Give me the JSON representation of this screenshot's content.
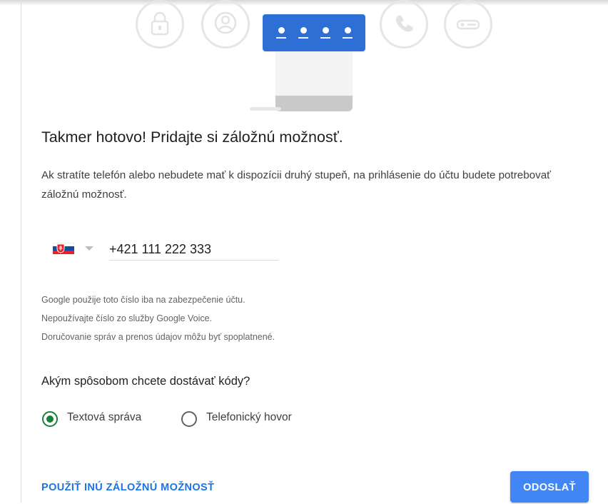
{
  "hero": {
    "icons": [
      "lock-icon",
      "user-circle-icon",
      "password-dots-card",
      "phone-icon",
      "key-icon"
    ],
    "card_color": "#2e6fd6"
  },
  "title": "Takmer hotovo! Pridajte si záložnú možnosť.",
  "description": "Ak stratíte telefón alebo nebudete mať k dispozícii druhý stupeň, na prihlásenie do účtu budete potrebovať záložnú možnosť.",
  "phone": {
    "country_flag": "slovakia-flag",
    "value": "+421 111 222 333"
  },
  "notes": [
    "Google použije toto číslo iba na zabezpečenie účtu.",
    "Nepoužívajte číslo zo služby Google Voice.",
    "Doručovanie správ a prenos údajov môžu byť spoplatnené."
  ],
  "question": "Akým spôsobom chcete dostávať kódy?",
  "options": [
    {
      "label": "Textová správa",
      "selected": true
    },
    {
      "label": "Telefonický hovor",
      "selected": false
    }
  ],
  "actions": {
    "alt_option": "POUŽIŤ INÚ ZÁLOŽNÚ MOŽNOSŤ",
    "send": "ODOSLAŤ"
  },
  "colors": {
    "accent": "#1a73e8",
    "button": "#4285f4",
    "radio_selected": "#188038"
  }
}
